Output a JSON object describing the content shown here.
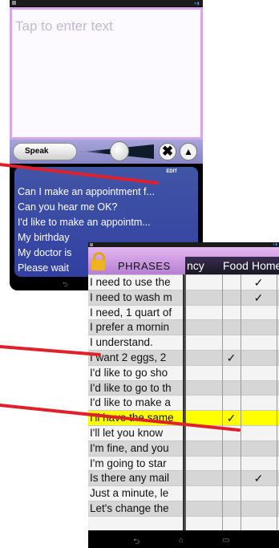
{
  "phone1": {
    "input_placeholder": "Tap to enter text",
    "speak_label": "Speak",
    "clear_glyph": "✖",
    "up_glyph": "▲",
    "list_header": {
      "edit_label": "EDIT"
    },
    "phrases": [
      "Can I make an appointment f...",
      "Can you hear me OK?",
      "I'd like to make an appointm...",
      "My birthday",
      "My doctor is",
      "Please wait"
    ]
  },
  "phone2": {
    "title": "PHRASES",
    "categories": [
      "ncy",
      "Food",
      "Home"
    ],
    "rows": [
      {
        "text": "I need to use the",
        "checks": [
          "",
          "",
          "✓"
        ]
      },
      {
        "text": "I need to wash m",
        "checks": [
          "",
          "",
          "✓"
        ]
      },
      {
        "text": "I need, 1 quart of",
        "checks": [
          "",
          "",
          ""
        ]
      },
      {
        "text": "I prefer a mornin",
        "checks": [
          "",
          "",
          ""
        ]
      },
      {
        "text": "I understand.",
        "checks": [
          "",
          "",
          ""
        ]
      },
      {
        "text": "I want 2 eggs, 2",
        "checks": [
          "",
          "✓",
          ""
        ]
      },
      {
        "text": "I'd like to go sho",
        "checks": [
          "",
          "",
          ""
        ]
      },
      {
        "text": "I'd like to go to th",
        "checks": [
          "",
          "",
          ""
        ]
      },
      {
        "text": "I'd like to make a",
        "checks": [
          "",
          "",
          ""
        ]
      },
      {
        "text": "I'll have the same",
        "checks": [
          "",
          "✓",
          ""
        ],
        "highlight": true
      },
      {
        "text": "I'll let you know",
        "checks": [
          "",
          "",
          ""
        ]
      },
      {
        "text": "I'm fine, and you",
        "checks": [
          "",
          "",
          ""
        ]
      },
      {
        "text": "I'm going to star",
        "checks": [
          "",
          "",
          ""
        ]
      },
      {
        "text": "Is there any mail",
        "checks": [
          "",
          "",
          "✓"
        ]
      },
      {
        "text": "Just a minute, le",
        "checks": [
          "",
          "",
          ""
        ]
      },
      {
        "text": "Let's change the",
        "checks": [
          "",
          "",
          ""
        ]
      },
      {
        "text": "",
        "checks": [
          "",
          "",
          ""
        ]
      }
    ]
  },
  "colors": {
    "callout": "#e0202a",
    "highlight": "#ffff00",
    "header_purple": "#c98fe0",
    "list_blue": "#3a4aa3"
  }
}
